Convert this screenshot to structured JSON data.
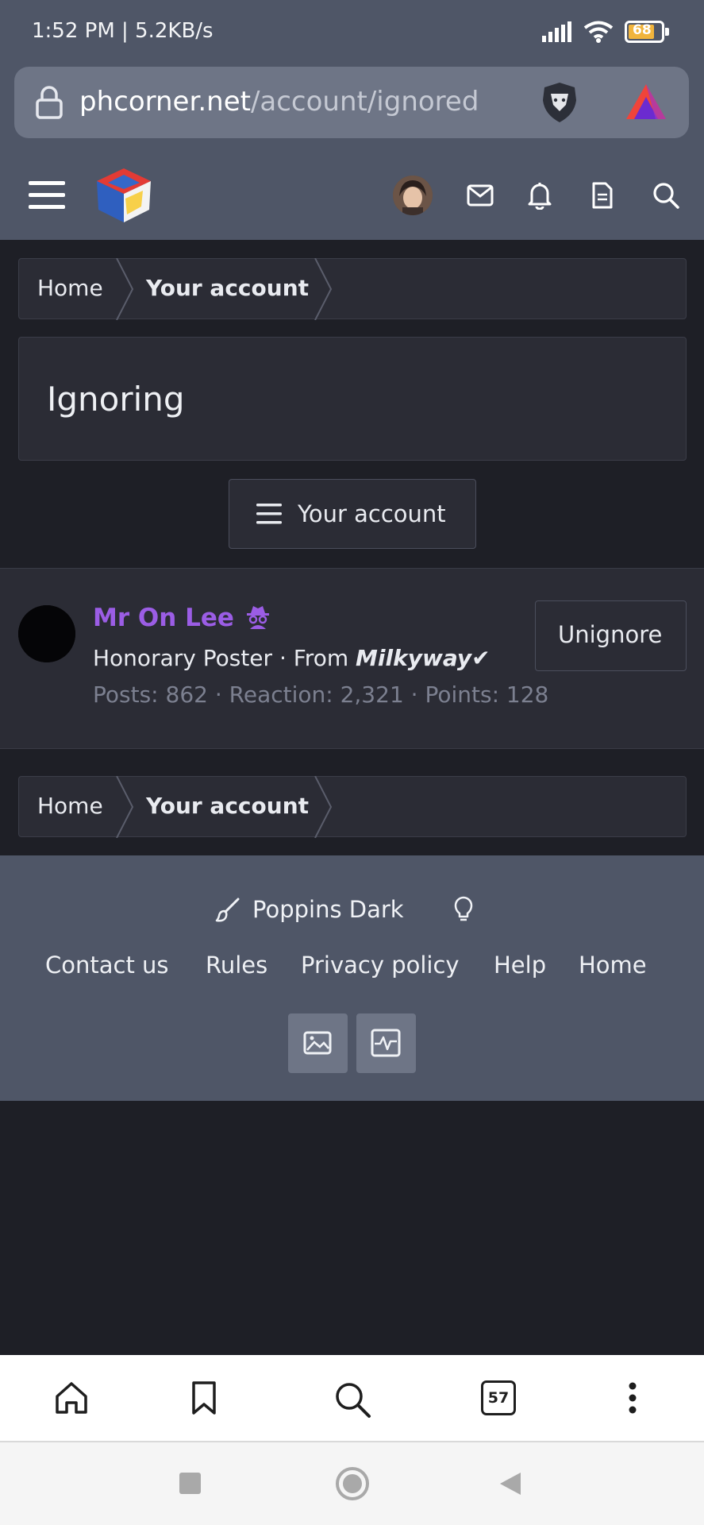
{
  "status_bar": {
    "time_speed": "1:52 PM | 5.2KB/s",
    "battery": "68"
  },
  "browser": {
    "url_domain": "phcorner.net",
    "url_path": "/account/ignored"
  },
  "breadcrumb": {
    "home": "Home",
    "current": "Your account"
  },
  "page": {
    "title": "Ignoring",
    "account_button": "Your account"
  },
  "ignored_users": [
    {
      "name": "Mr On Lee",
      "title_prefix": "Honorary Poster · From ",
      "location": "Milkyway✔",
      "stats": "Posts: 862 · Reaction: 2,321 · Points: 128",
      "action": "Unignore"
    }
  ],
  "footer": {
    "style_name": "Poppins Dark",
    "links": [
      "Contact us",
      "Rules",
      "Privacy policy",
      "Help",
      "Home"
    ]
  },
  "bottom_nav": {
    "tab_count": "57"
  },
  "colors": {
    "header_bg": "#4f5667",
    "page_bg": "#1e1f26",
    "panel_bg": "#2b2c35",
    "username": "#9b5de5"
  },
  "icons": {
    "status": [
      "signal-icon",
      "wifi-icon",
      "battery-icon"
    ],
    "header": [
      "menu-icon",
      "site-logo",
      "avatar",
      "mail-icon",
      "bell-icon",
      "document-icon",
      "search-icon"
    ],
    "footer": [
      "paintbrush-icon",
      "lightbulb-icon",
      "image-icon",
      "activity-icon"
    ],
    "bottom_nav": [
      "home-icon",
      "bookmark-icon",
      "search-icon",
      "tabs-icon",
      "more-icon"
    ]
  }
}
